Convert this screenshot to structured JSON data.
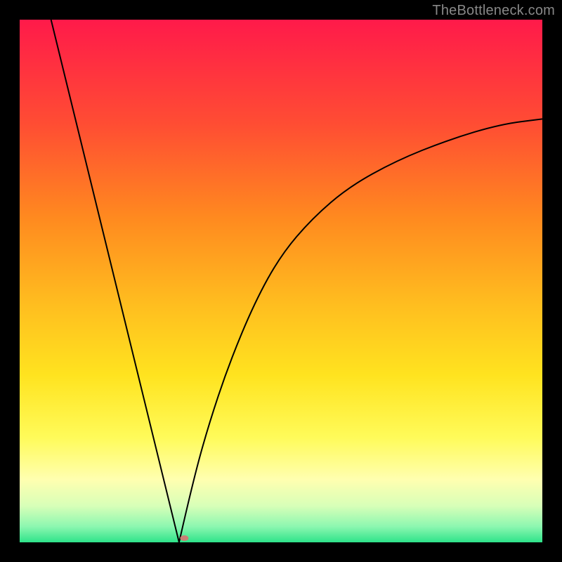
{
  "watermark": "TheBottleneck.com",
  "chart_data": {
    "type": "line",
    "title": "",
    "xlabel": "",
    "ylabel": "",
    "xlim": [
      0,
      100
    ],
    "ylim": [
      0,
      100
    ],
    "grid": false,
    "gradient_stops": [
      {
        "pos": 0.0,
        "color": "#ff1a4a"
      },
      {
        "pos": 0.2,
        "color": "#ff4d33"
      },
      {
        "pos": 0.38,
        "color": "#ff8a1f"
      },
      {
        "pos": 0.55,
        "color": "#ffbf1f"
      },
      {
        "pos": 0.68,
        "color": "#ffe31f"
      },
      {
        "pos": 0.8,
        "color": "#fffb5a"
      },
      {
        "pos": 0.88,
        "color": "#ffffb0"
      },
      {
        "pos": 0.93,
        "color": "#d8ffb8"
      },
      {
        "pos": 0.97,
        "color": "#8cf7b0"
      },
      {
        "pos": 1.0,
        "color": "#2ee38a"
      }
    ],
    "series": [
      {
        "name": "left-branch",
        "x": [
          6,
          30.5
        ],
        "y": [
          100,
          0
        ],
        "note": "straight descending line"
      },
      {
        "name": "right-branch",
        "x": [
          30.5,
          33,
          36,
          40,
          45,
          50,
          56,
          63,
          72,
          82,
          92,
          100
        ],
        "y": [
          0,
          11,
          22,
          34,
          46,
          55,
          62,
          68,
          73,
          77,
          80,
          81
        ],
        "note": "concave-increasing curve leveling off"
      }
    ],
    "marker": {
      "x": 31.5,
      "y": 0.8,
      "color": "#c97f75",
      "rx": 6,
      "ry": 4
    },
    "line_color": "#000000",
    "line_width": 2
  }
}
